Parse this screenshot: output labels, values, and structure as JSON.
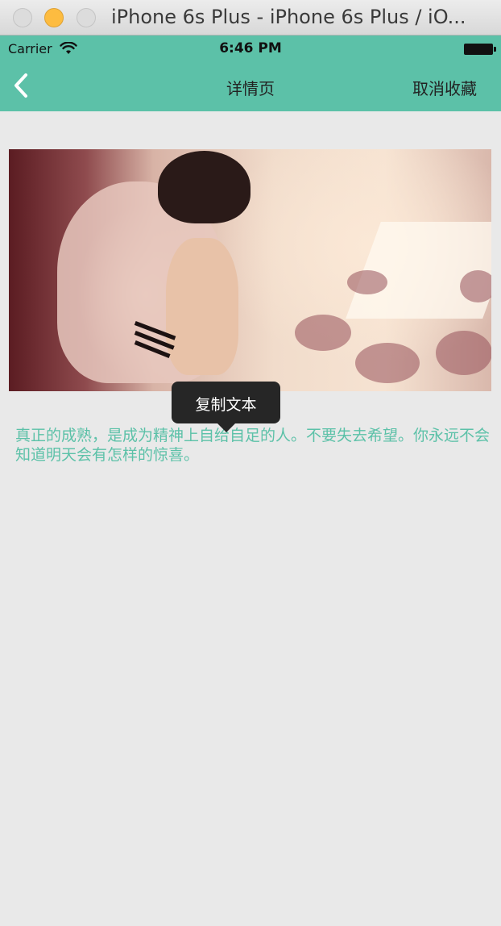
{
  "window": {
    "title": "iPhone 6s Plus - iPhone 6s Plus / iO..."
  },
  "status_bar": {
    "carrier": "Carrier",
    "time": "6:46 PM"
  },
  "nav": {
    "title": "详情页",
    "right_button": "取消收藏"
  },
  "content": {
    "quote": "真正的成熟，是成为精神上自给自足的人。不要失去希望。你永远不会知道明天会有怎样的惊喜。"
  },
  "popover": {
    "copy_label": "复制文本"
  },
  "colors": {
    "accent": "#5cc1a8",
    "background": "#e9e9e9",
    "popover": "#262626"
  },
  "icons": {
    "back": "chevron-left-icon",
    "wifi": "wifi-icon",
    "battery": "battery-icon"
  }
}
